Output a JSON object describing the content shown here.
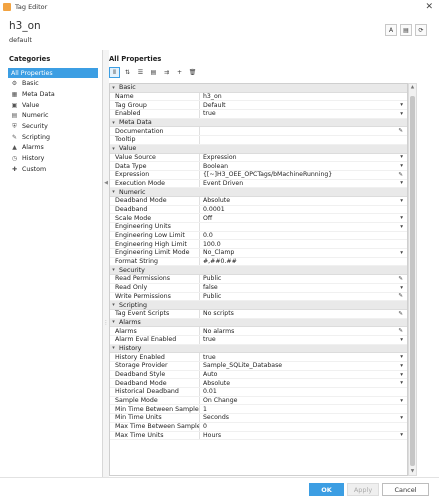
{
  "window": {
    "title": "Tag Editor",
    "close_glyph": "✕"
  },
  "header": {
    "tag_name": "h3_on",
    "provider": "default",
    "buttons": [
      {
        "name": "font-icon",
        "glyph": "A"
      },
      {
        "name": "notes-icon",
        "glyph": "▤"
      },
      {
        "name": "refresh-icon",
        "glyph": "⟳"
      }
    ]
  },
  "categories": {
    "title": "Categories",
    "items": [
      {
        "label": "All Properties",
        "icon": "",
        "selected": true
      },
      {
        "label": "Basic",
        "icon": "⚙"
      },
      {
        "label": "Meta Data",
        "icon": "▦"
      },
      {
        "label": "Value",
        "icon": "▣"
      },
      {
        "label": "Numeric",
        "icon": "▤"
      },
      {
        "label": "Security",
        "icon": "⛨"
      },
      {
        "label": "Scripting",
        "icon": "✎"
      },
      {
        "label": "Alarms",
        "icon": "▲"
      },
      {
        "label": "History",
        "icon": "◷"
      },
      {
        "label": "Custom",
        "icon": "✚"
      }
    ]
  },
  "properties": {
    "title": "All Properties",
    "toolbar": [
      {
        "name": "grid-view-icon",
        "glyph": "⦀",
        "active": true
      },
      {
        "name": "sort-icon",
        "glyph": "⇅"
      },
      {
        "name": "list-icon",
        "glyph": "☰"
      },
      {
        "name": "expand-all-icon",
        "glyph": "▤"
      },
      {
        "name": "collapse-all-icon",
        "glyph": "⇉"
      },
      {
        "name": "add-icon",
        "glyph": "+"
      },
      {
        "name": "delete-icon",
        "glyph": "🗑"
      }
    ],
    "rows": [
      {
        "section": "Basic"
      },
      {
        "name": "Name",
        "value": "h3_on"
      },
      {
        "name": "Tag Group",
        "value": "Default",
        "ctrl": "▾"
      },
      {
        "name": "Enabled",
        "value": "true",
        "ctrl": "▾"
      },
      {
        "section": "Meta Data"
      },
      {
        "name": "Documentation",
        "value": "",
        "ctrl": "✎"
      },
      {
        "name": "Tooltip",
        "value": ""
      },
      {
        "section": "Value"
      },
      {
        "name": "Value Source",
        "value": "Expression",
        "ctrl": "▾"
      },
      {
        "name": "Data Type",
        "value": "Boolean",
        "ctrl": "▾"
      },
      {
        "name": "Expression",
        "value": "{[~]H3_OEE_OPCTags/bMachineRunning}",
        "ctrl": "✎"
      },
      {
        "name": "Execution Mode",
        "value": "Event Driven",
        "ctrl": "▾"
      },
      {
        "section": "Numeric"
      },
      {
        "name": "Deadband Mode",
        "value": "Absolute",
        "ctrl": "▾"
      },
      {
        "name": "Deadband",
        "value": "0.0001"
      },
      {
        "name": "Scale Mode",
        "value": "Off",
        "ctrl": "▾"
      },
      {
        "name": "Engineering Units",
        "value": "",
        "ctrl": "▾"
      },
      {
        "name": "Engineering Low Limit",
        "value": "0.0"
      },
      {
        "name": "Engineering High Limit",
        "value": "100.0"
      },
      {
        "name": "Engineering Limit Mode",
        "value": "No_Clamp",
        "ctrl": "▾"
      },
      {
        "name": "Format String",
        "value": "#,##0.##"
      },
      {
        "section": "Security"
      },
      {
        "name": "Read Permissions",
        "value": "Public",
        "ctrl": "✎"
      },
      {
        "name": "Read Only",
        "value": "false",
        "ctrl": "▾"
      },
      {
        "name": "Write Permissions",
        "value": "Public",
        "ctrl": "✎"
      },
      {
        "section": "Scripting"
      },
      {
        "name": "Tag Event Scripts",
        "value": "No scripts",
        "ctrl": "✎"
      },
      {
        "section": "Alarms"
      },
      {
        "name": "Alarms",
        "value": "No alarms",
        "ctrl": "✎"
      },
      {
        "name": "Alarm Eval Enabled",
        "value": "true",
        "ctrl": "▾"
      },
      {
        "section": "History"
      },
      {
        "name": "History Enabled",
        "value": "true",
        "ctrl": "▾"
      },
      {
        "name": "Storage Provider",
        "value": "Sample_SQLite_Database",
        "ctrl": "▾"
      },
      {
        "name": "Deadband Style",
        "value": "Auto",
        "ctrl": "▾"
      },
      {
        "name": "Deadband Mode",
        "value": "Absolute",
        "ctrl": "▾"
      },
      {
        "name": "Historical Deadband",
        "value": "0.01"
      },
      {
        "name": "Sample Mode",
        "value": "On Change",
        "ctrl": "▾"
      },
      {
        "name": "Min Time Between Samples",
        "value": "1"
      },
      {
        "name": "Min Time Units",
        "value": "Seconds",
        "ctrl": "▾"
      },
      {
        "name": "Max Time Between Samples",
        "value": "0"
      },
      {
        "name": "Max Time Units",
        "value": "Hours",
        "ctrl": "▾"
      }
    ]
  },
  "footer": {
    "ok": "OK",
    "apply": "Apply",
    "cancel": "Cancel"
  },
  "colors": {
    "accent": "#3c9ee3",
    "section_bg": "#e9e9e9"
  }
}
